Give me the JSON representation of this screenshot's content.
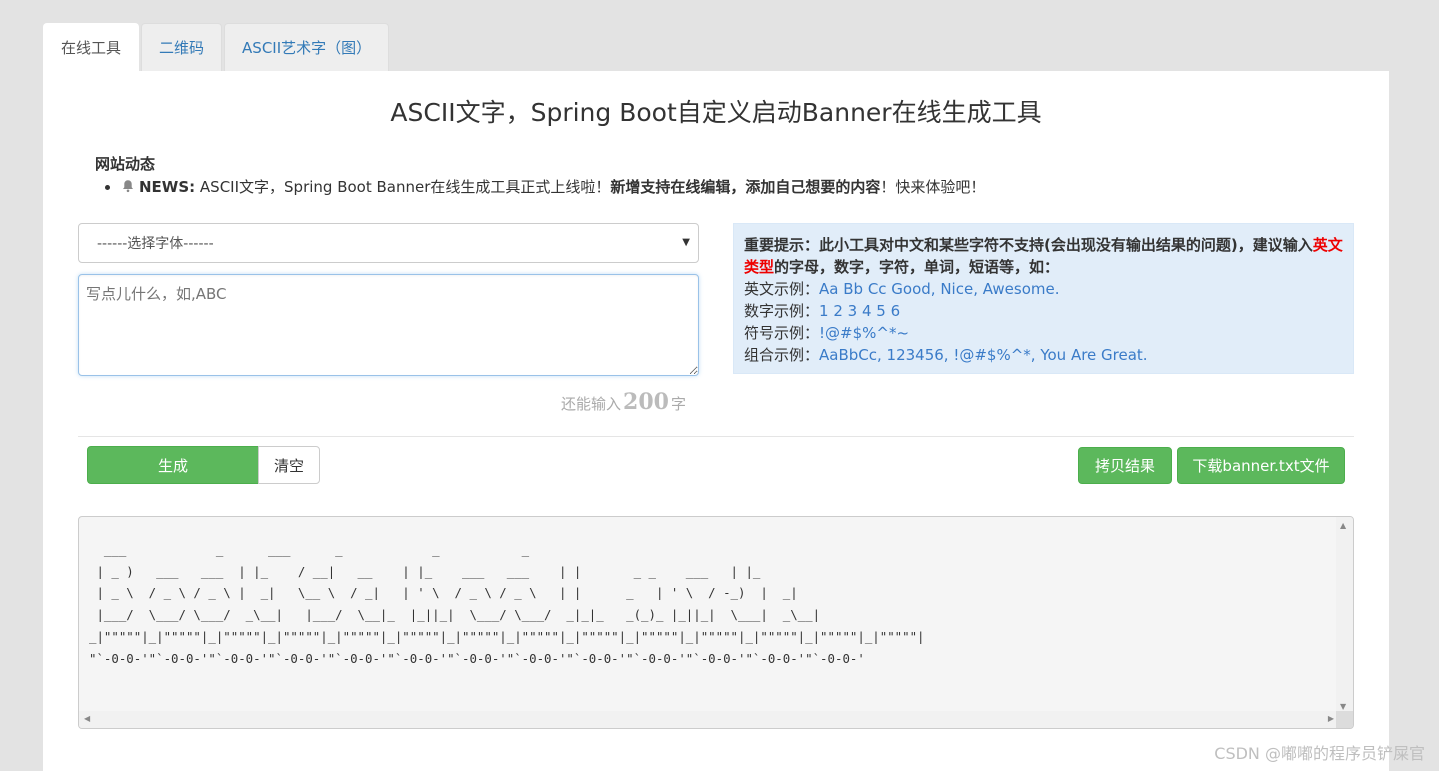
{
  "tabs": [
    {
      "label": "在线工具"
    },
    {
      "label": "二维码"
    },
    {
      "label": "ASCII艺术字（图）"
    }
  ],
  "page_title": "ASCII文字，Spring Boot自定义启动Banner在线生成工具",
  "news": {
    "heading": "网站动态",
    "tag": "NEWS:",
    "text_prefix": " ASCII文字，Spring Boot Banner在线生成工具正式上线啦！",
    "text_bold": "新增支持在线编辑，添加自己想要的内容",
    "text_suffix": "！快来体验吧！"
  },
  "font_select": {
    "value": "------选择字体------"
  },
  "text_input": {
    "placeholder": "写点儿什么，如,ABC",
    "value": ""
  },
  "counter": {
    "prefix": "还能输入",
    "num": "200",
    "suffix": "字"
  },
  "tip": {
    "bold1": "重要提示：此小工具对中文和某些字符不支持(会出现没有输出结果的问题)，建议输入",
    "red": "英文类型",
    "bold2": "的字母，数字，字符，单词，短语等，如：",
    "rows": [
      {
        "label": "英文示例：",
        "value": "Aa Bb Cc Good, Nice, Awesome."
      },
      {
        "label": "数字示例：",
        "value": "1 2 3 4 5 6"
      },
      {
        "label": "符号示例：",
        "value": "!@#$%^*~"
      },
      {
        "label": "组合示例：",
        "value": "AaBbCc, 123456, !@#$%^*, You Are Great."
      }
    ]
  },
  "buttons": {
    "generate": "生成",
    "clear": "清空",
    "copy": "拷贝结果",
    "download": "下载banner.txt文件"
  },
  "output_ascii": "  ___            _      ___      _            _           _\n | _ )   ___   ___  | |_    / __|   __    | |_    ___   ___    | |       _ _    ___   | |_\n | _ \\  / _ \\ / _ \\ |  _|   \\__ \\  / _|   | ' \\  / _ \\ / _ \\   | |      _   | ' \\  / -_)  |  _|\n |___/  \\___/ \\___/  _\\__|   |___/  \\__|_  |_||_|  \\___/ \\___/  _|_|_   _(_)_ |_||_|  \\___|  _\\__|\n_|\"\"\"\"\"|_|\"\"\"\"\"|_|\"\"\"\"\"|_|\"\"\"\"\"|_|\"\"\"\"\"|_|\"\"\"\"\"|_|\"\"\"\"\"|_|\"\"\"\"\"|_|\"\"\"\"\"|_|\"\"\"\"\"|_|\"\"\"\"\"|_|\"\"\"\"\"|_|\"\"\"\"\"|_|\"\"\"\"\"|\n\"`-0-0-'\"`-0-0-'\"`-0-0-'\"`-0-0-'\"`-0-0-'\"`-0-0-'\"`-0-0-'\"`-0-0-'\"`-0-0-'\"`-0-0-'\"`-0-0-'\"`-0-0-'\"`-0-0-'",
  "watermark": "CSDN @嘟嘟的程序员铲屎官",
  "colors": {
    "accent_green": "#5cb85c",
    "link_blue": "#337ab7",
    "tip_bg": "#e1edf9",
    "highlight_red": "#ee0000"
  }
}
